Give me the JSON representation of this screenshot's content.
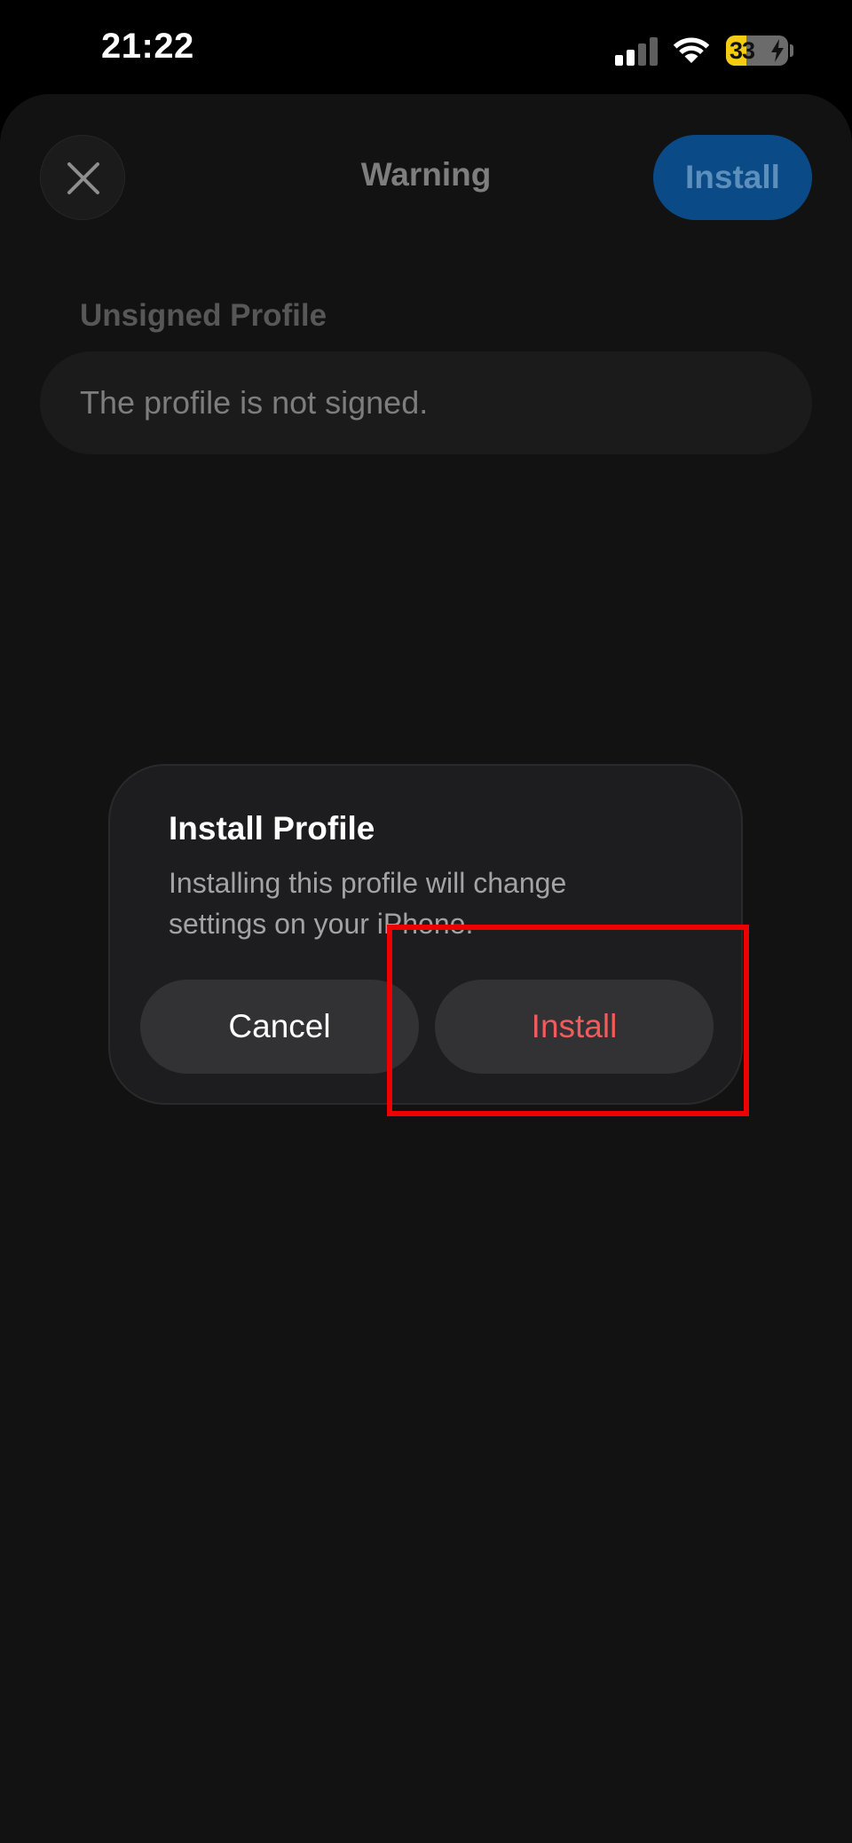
{
  "status_bar": {
    "time": "21:22",
    "battery_percent": 33,
    "battery_text": "33",
    "battery_color": "#f5cc14",
    "charging": true,
    "icons": [
      "cellular-signal-icon",
      "wifi-icon",
      "battery-icon",
      "charging-bolt-icon"
    ]
  },
  "nav": {
    "title": "Warning",
    "close_icon": "close-icon",
    "install_label": "Install",
    "install_color": "#0a4a86"
  },
  "content": {
    "section_header": "Unsigned Profile",
    "info_text": "The profile is not signed."
  },
  "alert": {
    "title": "Install Profile",
    "message": "Installing this profile will change settings on your iPhone.",
    "cancel_label": "Cancel",
    "install_label": "Install",
    "destructive_color": "#f25b5b"
  },
  "annotation": {
    "highlight_color": "#ee0000"
  }
}
